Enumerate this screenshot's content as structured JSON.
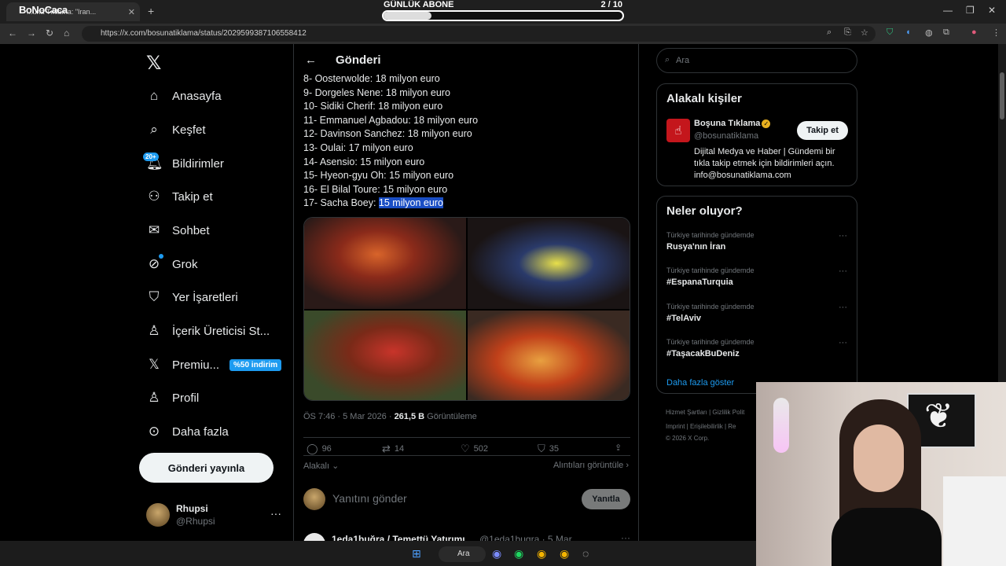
{
  "browser": {
    "tab_title": "...una Tıklama: \"Iran...",
    "brand_overlay": "BoNoCaca",
    "url": "https://x.com/bosunatiklama/status/2029599387106558412"
  },
  "subs_widget": {
    "label": "GÜNLÜK ABONE",
    "count": "2  / 10",
    "progress": 0.2
  },
  "sidebar": {
    "items": [
      {
        "label": "Anasayfa",
        "icon": "home-icon"
      },
      {
        "label": "Keşfet",
        "icon": "search-icon"
      },
      {
        "label": "Bildirimler",
        "icon": "bell-icon"
      },
      {
        "label": "Takip et",
        "icon": "add-person-icon"
      },
      {
        "label": "Sohbet",
        "icon": "mail-icon"
      },
      {
        "label": "Grok",
        "icon": "grok-icon"
      },
      {
        "label": "Yer İşaretleri",
        "icon": "bookmark-icon"
      },
      {
        "label": "İçerik Üreticisi St...",
        "icon": "creator-icon"
      },
      {
        "label": "Premiu...",
        "icon": "x-premium-icon"
      },
      {
        "label": "Profil",
        "icon": "person-icon"
      },
      {
        "label": "Daha fazla",
        "icon": "more-circle-icon"
      }
    ],
    "notif_badge": "20+",
    "premium_promo": "%50 indirim",
    "post_button": "Gönderi yayınla",
    "user": {
      "name": "Rhupsi",
      "handle": "@Rhupsi"
    }
  },
  "post": {
    "header_title": "Gönderi",
    "lines": [
      "8- Oosterwolde: 18 milyon euro",
      "9- Dorgeles Nene: 18 milyon euro",
      "10- Sidiki Cherif: 18 milyon euro",
      "11- Emmanuel Agbadou: 18 milyon euro",
      "12- Davinson Sanchez: 18 milyon euro",
      "13- Oulai: 17 milyon euro",
      "14- Asensio: 15 milyon euro",
      "15- Hyeon-gyu Oh: 15 milyon euro",
      "16- El Bilal Toure: 15 milyon euro"
    ],
    "last_line_prefix": "17- Sacha Boey: ",
    "last_line_highlight": "15 milyon euro",
    "time": "ÖS 7:46 · 5 Mar 2026 · ",
    "views": "261,5 B",
    "views_label": " Görüntüleme",
    "stats": {
      "replies": "96",
      "reposts": "14",
      "likes": "502",
      "bookmarks": "35"
    },
    "related_label": "Alakalı",
    "quotes_label": "Alıntıları görüntüle",
    "reply_placeholder": "Yanıtını gönder",
    "reply_button": "Yanıtla",
    "next_tweet_name": "1eda1buğra / Temettü Yatırımı",
    "next_tweet_handle": "@1eda1bugra · 5 Mar"
  },
  "right": {
    "search_placeholder": "Ara",
    "related_title": "Alakalı kişiler",
    "related_person": {
      "name": "Boşuna Tıklama",
      "handle": "@bosunatiklama",
      "bio": "Dijital Medya ve Haber | Gündemi bir tıkla takip etmek için bildirimleri açın. info@bosunatiklama.com",
      "follow": "Takip et"
    },
    "trends_title": "Neler oluyor?",
    "trends": [
      {
        "context": "Türkiye tarihinde gündemde",
        "title": "Rusya'nın İran"
      },
      {
        "context": "Türkiye tarihinde gündemde",
        "title": "#EspanaTurquia"
      },
      {
        "context": "Türkiye tarihinde gündemde",
        "title": "#TelAviv"
      },
      {
        "context": "Türkiye tarihinde gündemde",
        "title": "#TaşacakBuDeniz"
      }
    ],
    "show_more": "Daha fazla göster",
    "footer": [
      "Hizmet Şartları  |  Gizlilik Polit",
      "Imprint  |  Erişilebilirlik  |  Re",
      "© 2026 X Corp."
    ]
  },
  "taskbar": {
    "search": "Ara"
  }
}
